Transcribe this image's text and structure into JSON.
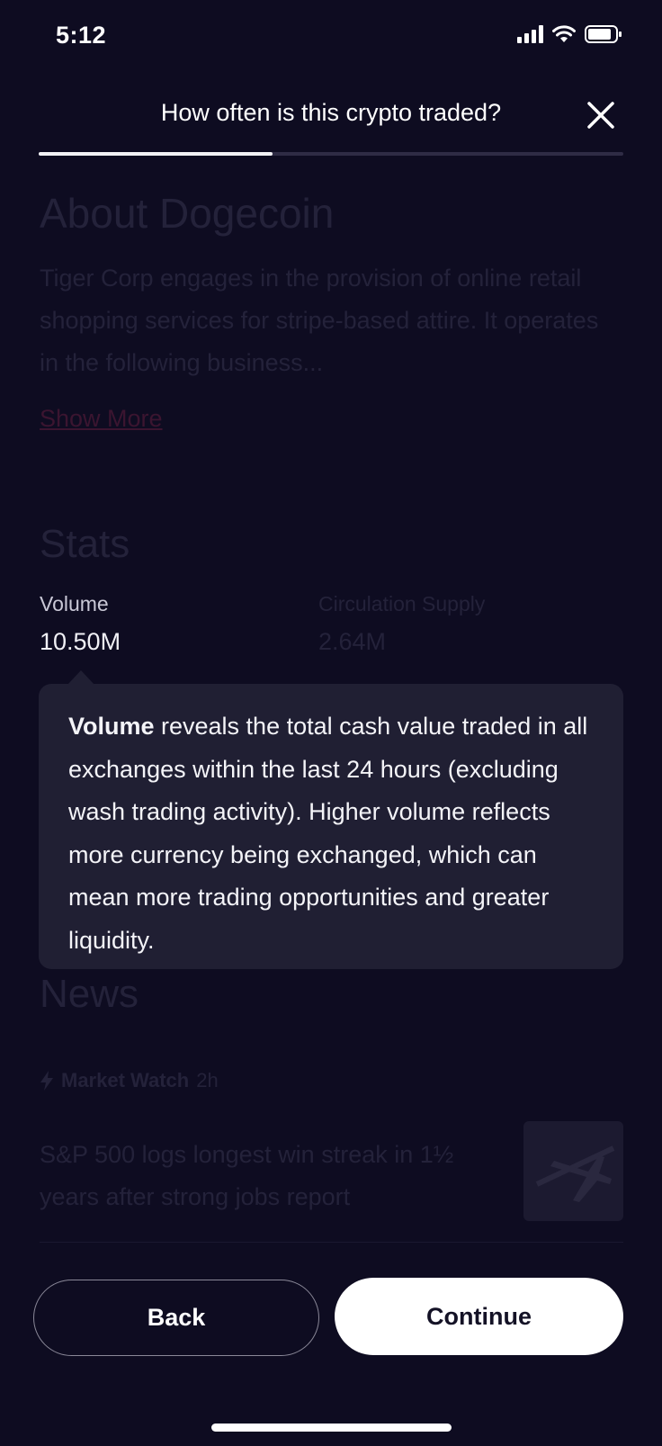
{
  "status_bar": {
    "time": "5:12"
  },
  "header": {
    "title": "How often is this crypto traded?",
    "progress": 0.4
  },
  "about": {
    "title": "About Dogecoin",
    "description": "Tiger Corp engages in the provision of online retail shopping services for stripe-based attire. It operates in the following business...",
    "show_more": "Show More"
  },
  "stats": {
    "title": "Stats",
    "volume_label": "Volume",
    "volume_value": "10.50M",
    "circulation_label": "Circulation Supply",
    "circulation_value": "2.64M"
  },
  "tooltip": {
    "term": "Volume",
    "text": " reveals the total cash value traded in all exchanges within the last 24 hours (excluding wash trading activity). Higher volume reflects more currency being exchanged, which can mean more trading opportunities and greater liquidity."
  },
  "news": {
    "title": "News",
    "source": "Market Watch",
    "age": "2h",
    "headline": "S&P 500 logs longest win streak in 1½ years after strong jobs report"
  },
  "buttons": {
    "back": "Back",
    "continue": "Continue"
  }
}
